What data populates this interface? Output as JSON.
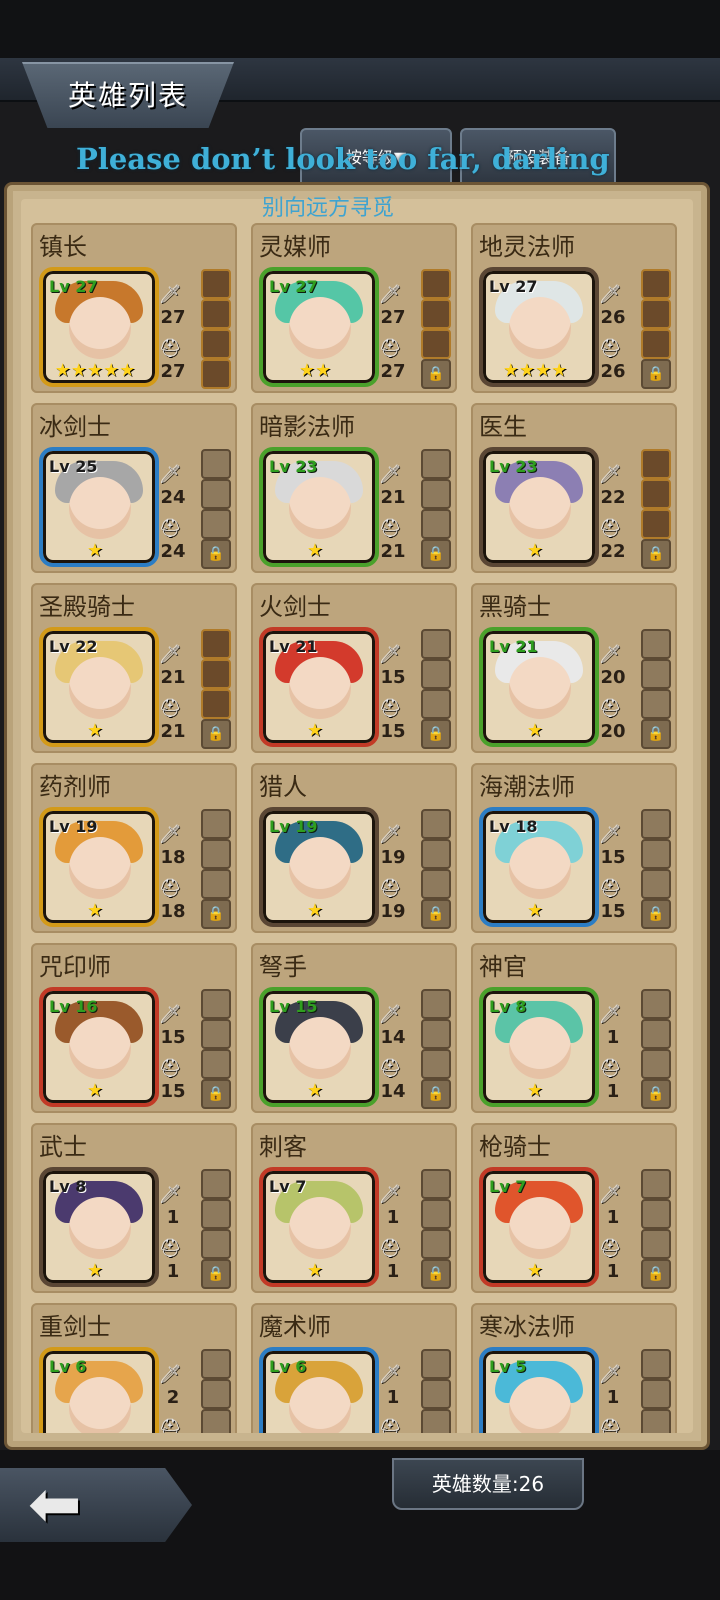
{
  "header": {
    "title": "英雄列表",
    "tabs": [
      {
        "label": "按等级▼"
      },
      {
        "label": "预设装备"
      }
    ]
  },
  "overlay": {
    "line1": "Please don’t look too far, darling",
    "line2": "别向远方寻觅"
  },
  "heroes": [
    {
      "name": "镇长",
      "level": "Lv 27",
      "attack": "27",
      "defense": "27",
      "stars": "★★★★★"
    },
    {
      "name": "灵媒师",
      "level": "Lv 27",
      "attack": "27",
      "defense": "27",
      "stars": "★★"
    },
    {
      "name": "地灵法师",
      "level": "Lv 27",
      "attack": "26",
      "defense": "26",
      "stars": "★★★★"
    },
    {
      "name": "冰剑士",
      "level": "Lv 25",
      "attack": "24",
      "defense": "24",
      "stars": "★"
    },
    {
      "name": "暗影法师",
      "level": "Lv 23",
      "attack": "21",
      "defense": "21",
      "stars": "★"
    },
    {
      "name": "医生",
      "level": "Lv 23",
      "attack": "22",
      "defense": "22",
      "stars": "★"
    },
    {
      "name": "圣殿骑士",
      "level": "Lv 22",
      "attack": "21",
      "defense": "21",
      "stars": "★"
    },
    {
      "name": "火剑士",
      "level": "Lv 21",
      "attack": "15",
      "defense": "15",
      "stars": "★"
    },
    {
      "name": "黑骑士",
      "level": "Lv 21",
      "attack": "20",
      "defense": "20",
      "stars": "★"
    },
    {
      "name": "药剂师",
      "level": "Lv 19",
      "attack": "18",
      "defense": "18",
      "stars": "★"
    },
    {
      "name": "猎人",
      "level": "Lv 19",
      "attack": "19",
      "defense": "19",
      "stars": "★"
    },
    {
      "name": "海潮法师",
      "level": "Lv 18",
      "attack": "15",
      "defense": "15",
      "stars": "★"
    },
    {
      "name": "咒印师",
      "level": "Lv 16",
      "attack": "15",
      "defense": "15",
      "stars": "★"
    },
    {
      "name": "弩手",
      "level": "Lv 15",
      "attack": "14",
      "defense": "14",
      "stars": "★"
    },
    {
      "name": "神官",
      "level": "Lv 8",
      "attack": "1",
      "defense": "1",
      "stars": "★"
    },
    {
      "name": "武士",
      "level": "Lv 8",
      "attack": "1",
      "defense": "1",
      "stars": "★"
    },
    {
      "name": "刺客",
      "level": "Lv 7",
      "attack": "1",
      "defense": "1",
      "stars": "★"
    },
    {
      "name": "枪骑士",
      "level": "Lv 7",
      "attack": "1",
      "defense": "1",
      "stars": "★"
    },
    {
      "name": "重剑士",
      "level": "Lv 6",
      "attack": "2",
      "defense": "",
      "stars": ""
    },
    {
      "name": "魔术师",
      "level": "Lv 6",
      "attack": "1",
      "defense": "",
      "stars": ""
    },
    {
      "name": "寒冰法师",
      "level": "Lv 5",
      "attack": "1",
      "defense": "",
      "stars": ""
    }
  ],
  "footer": {
    "hero_count": "英雄数量:26",
    "back_icon": "back-arrow-icon"
  },
  "icons": {
    "attack": "sword-icon",
    "defense": "helmet-icon",
    "lock": "lock-icon"
  },
  "colors": {
    "panel": "#c8b48e",
    "card": "#bda57d",
    "level_green": "#2f9e1f",
    "star": "#ffd21a"
  }
}
